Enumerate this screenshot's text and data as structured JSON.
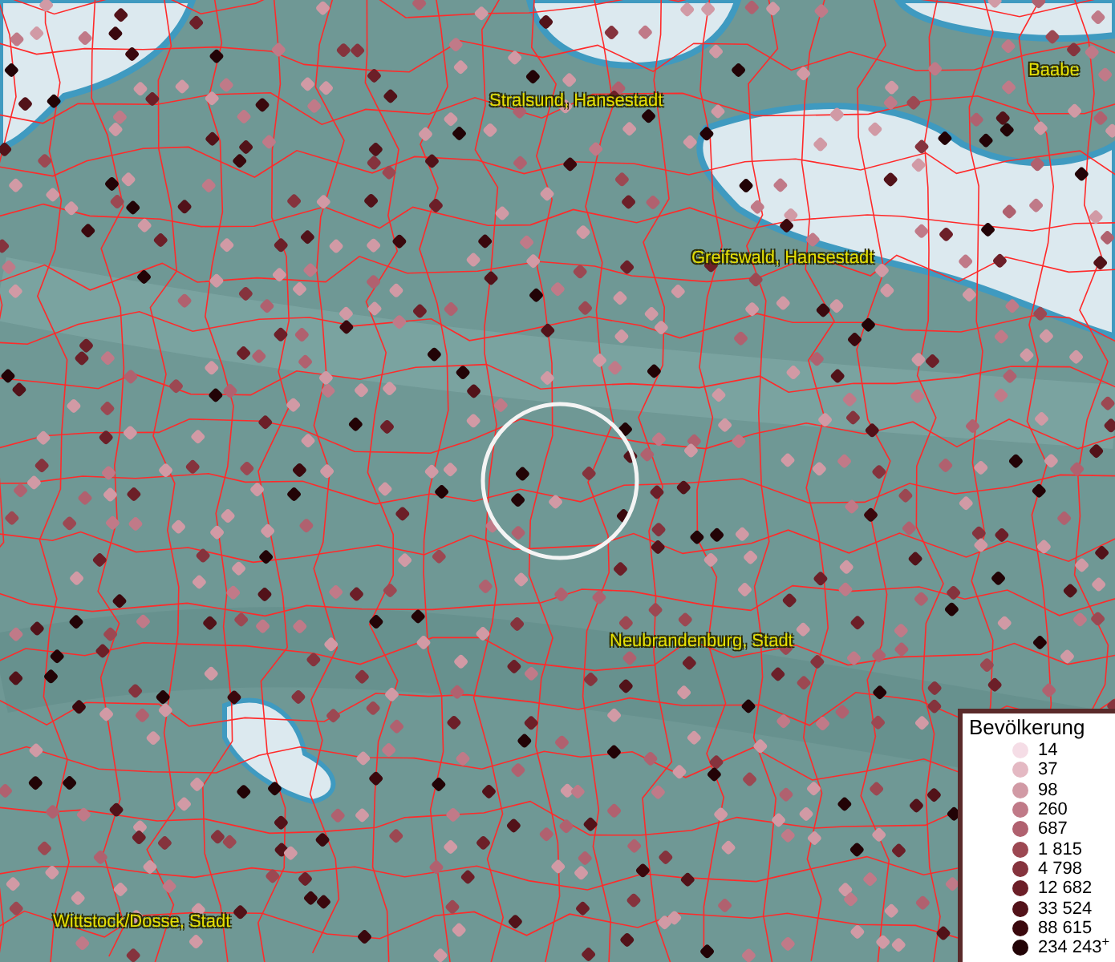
{
  "map": {
    "place_labels": [
      {
        "name": "Stralsund, Hansestadt"
      },
      {
        "name": "Baabe"
      },
      {
        "name": "Greifswald, Hansestadt"
      },
      {
        "name": "Neubrandenburg, Stadt"
      },
      {
        "name": "Wittstock/Dosse, Stadt"
      }
    ]
  },
  "legend": {
    "title": "Bevölkerung",
    "items": [
      {
        "label": "14",
        "color": "#f5dde6"
      },
      {
        "label": "37",
        "color": "#e4b9c3"
      },
      {
        "label": "98",
        "color": "#d19aa5"
      },
      {
        "label": "260",
        "color": "#c07a88"
      },
      {
        "label": "687",
        "color": "#b0616f"
      },
      {
        "label": "1 815",
        "color": "#9c4852"
      },
      {
        "label": "4 798",
        "color": "#85333d"
      },
      {
        "label": "12 682",
        "color": "#6c1f28"
      },
      {
        "label": "33 524",
        "color": "#521219"
      },
      {
        "label": "88 615",
        "color": "#3a080d"
      },
      {
        "label": "234 243$^{+}$",
        "color": "#220306"
      }
    ]
  }
}
